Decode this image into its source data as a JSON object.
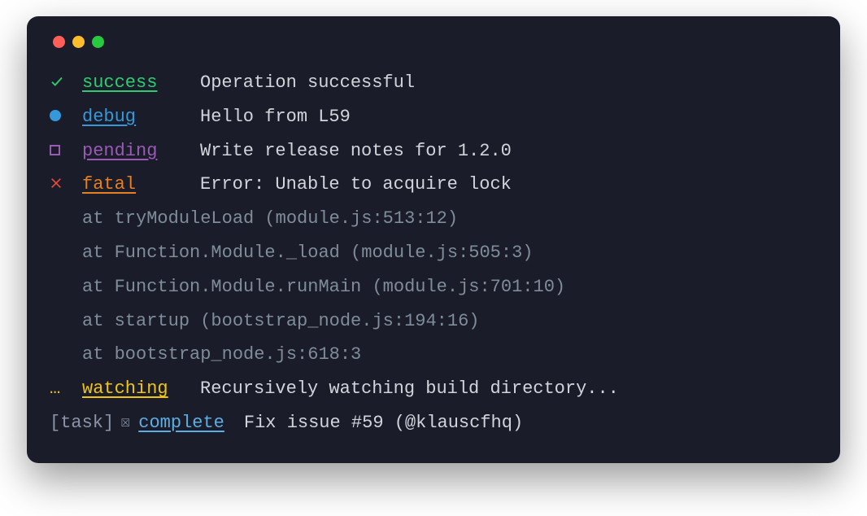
{
  "lines": {
    "success": {
      "label": "success",
      "msg": "Operation successful"
    },
    "debug": {
      "label": "debug",
      "msg": "Hello from L59"
    },
    "pending": {
      "label": "pending",
      "msg": "Write release notes for 1.2.0"
    },
    "fatal": {
      "label": "fatal",
      "msg": "Error: Unable to acquire lock"
    },
    "watching": {
      "label": "watching",
      "msg": "Recursively watching build directory...",
      "icon": "…"
    }
  },
  "stack": [
    "at tryModuleLoad (module.js:513:12)",
    "at Function.Module._load (module.js:505:3)",
    "at Function.Module.runMain (module.js:701:10)",
    "at startup (bootstrap_node.js:194:16)",
    "at bootstrap_node.js:618:3"
  ],
  "task": {
    "prefix": "[task]",
    "check": "☒",
    "label": "complete",
    "msg": "Fix issue #59 (@klauscfhq)"
  }
}
